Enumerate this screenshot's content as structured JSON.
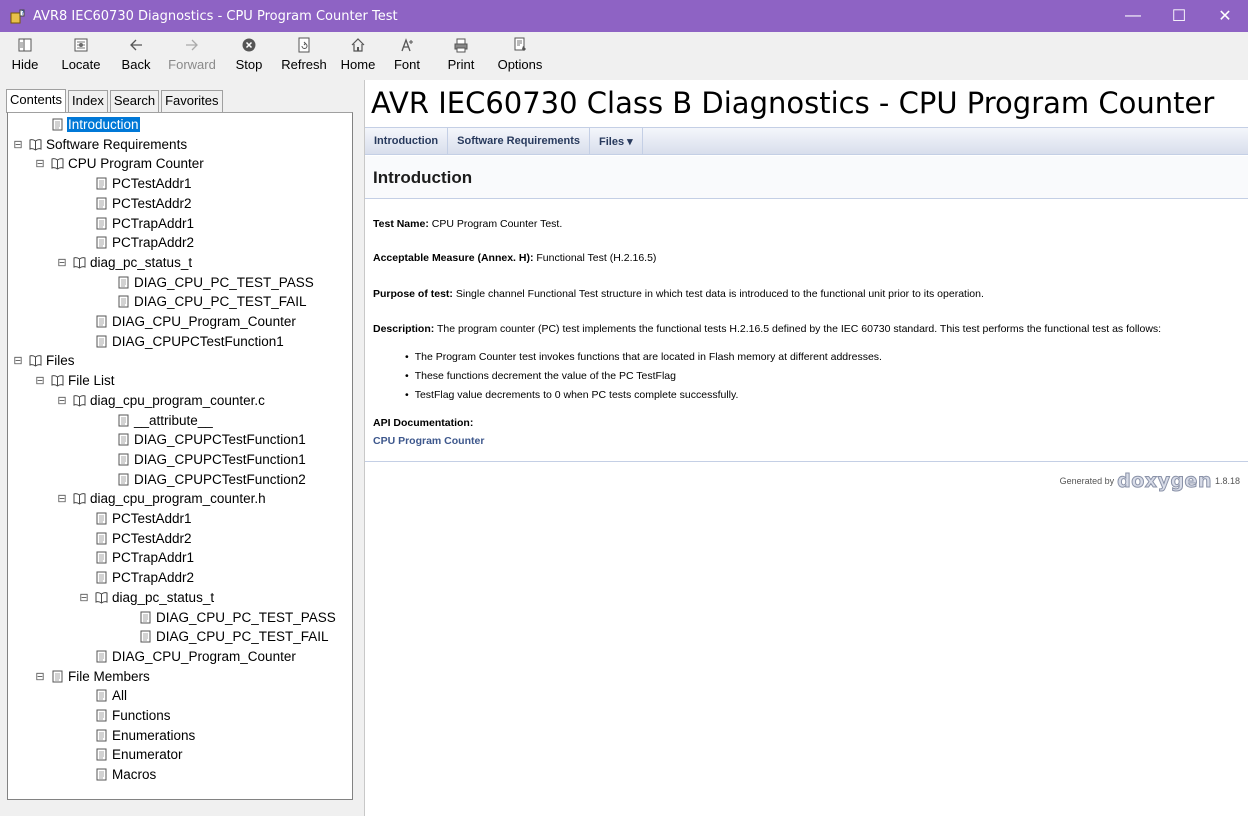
{
  "window": {
    "title": "AVR8 IEC60730 Diagnostics - CPU Program Counter Test",
    "controls": [
      "—",
      "☐",
      "✕"
    ]
  },
  "toolbar": {
    "hide": "Hide",
    "locate": "Locate",
    "back": "Back",
    "forward": "Forward",
    "stop": "Stop",
    "refresh": "Refresh",
    "home": "Home",
    "font": "Font",
    "print": "Print",
    "options": "Options"
  },
  "tabs": {
    "contents": "Contents",
    "index": "Index",
    "search": "Search",
    "favorites": "Favorites"
  },
  "tree": [
    {
      "label": "Introduction",
      "type": "page",
      "expander": "",
      "selected": true
    },
    {
      "label": "Software Requirements",
      "type": "book",
      "expander": "⊟"
    },
    {
      "label": "CPU Program Counter",
      "type": "book",
      "expander": "⊟"
    },
    {
      "label": "PCTestAddr1",
      "type": "page",
      "expander": ""
    },
    {
      "label": "PCTestAddr2",
      "type": "page",
      "expander": ""
    },
    {
      "label": "PCTrapAddr1",
      "type": "page",
      "expander": ""
    },
    {
      "label": "PCTrapAddr2",
      "type": "page",
      "expander": ""
    },
    {
      "label": "diag_pc_status_t",
      "type": "book",
      "expander": "⊟"
    },
    {
      "label": "DIAG_CPU_PC_TEST_PASS",
      "type": "page",
      "expander": ""
    },
    {
      "label": "DIAG_CPU_PC_TEST_FAIL",
      "type": "page",
      "expander": ""
    },
    {
      "label": "DIAG_CPU_Program_Counter",
      "type": "page",
      "expander": ""
    },
    {
      "label": "DIAG_CPUPCTestFunction1",
      "type": "page",
      "expander": ""
    },
    {
      "label": "Files",
      "type": "book",
      "expander": "⊟"
    },
    {
      "label": "File List",
      "type": "book",
      "expander": "⊟"
    },
    {
      "label": "diag_cpu_program_counter.c",
      "type": "book",
      "expander": "⊟"
    },
    {
      "label": "__attribute__",
      "type": "page",
      "expander": ""
    },
    {
      "label": "DIAG_CPUPCTestFunction1",
      "type": "page",
      "expander": ""
    },
    {
      "label": "DIAG_CPUPCTestFunction1",
      "type": "page",
      "expander": ""
    },
    {
      "label": "DIAG_CPUPCTestFunction2",
      "type": "page",
      "expander": ""
    },
    {
      "label": "diag_cpu_program_counter.h",
      "type": "book",
      "expander": "⊟"
    },
    {
      "label": "PCTestAddr1",
      "type": "page",
      "expander": ""
    },
    {
      "label": "PCTestAddr2",
      "type": "page",
      "expander": ""
    },
    {
      "label": "PCTrapAddr1",
      "type": "page",
      "expander": ""
    },
    {
      "label": "PCTrapAddr2",
      "type": "page",
      "expander": ""
    },
    {
      "label": "diag_pc_status_t",
      "type": "book",
      "expander": "⊟"
    },
    {
      "label": "DIAG_CPU_PC_TEST_PASS",
      "type": "page",
      "expander": ""
    },
    {
      "label": "DIAG_CPU_PC_TEST_FAIL",
      "type": "page",
      "expander": ""
    },
    {
      "label": "DIAG_CPU_Program_Counter",
      "type": "page",
      "expander": ""
    },
    {
      "label": "File Members",
      "type": "page",
      "expander": "⊟"
    },
    {
      "label": "All",
      "type": "page",
      "expander": ""
    },
    {
      "label": "Functions",
      "type": "page",
      "expander": ""
    },
    {
      "label": "Enumerations",
      "type": "page",
      "expander": ""
    },
    {
      "label": "Enumerator",
      "type": "page",
      "expander": ""
    },
    {
      "label": "Macros",
      "type": "page",
      "expander": ""
    }
  ],
  "doc": {
    "title": "AVR IEC60730 Class B Diagnostics - CPU Program Counter",
    "nav": {
      "introduction": "Introduction",
      "software_requirements": "Software Requirements",
      "files": "Files ▾"
    },
    "heading": "Introduction",
    "test_name_label": "Test Name:",
    "test_name": " CPU Program Counter Test.",
    "measure_label": "Acceptable Measure (Annex. H):",
    "measure": " Functional Test (H.2.16.5)",
    "purpose_label": "Purpose of test:",
    "purpose": " Single channel Functional Test structure in which test data is introduced to the functional unit prior to its operation.",
    "description_label": "Description:",
    "description": " The program counter (PC) test implements the functional tests H.2.16.5 defined by the IEC 60730 standard. This test performs the functional test as follows:",
    "bullets": [
      "The Program Counter test invokes functions that are located in Flash memory at different addresses.",
      "These functions decrement the value of the PC TestFlag",
      "TestFlag value decrements to 0 when PC tests complete successfully."
    ],
    "api_label": "API Documentation:",
    "api_link": "CPU Program Counter",
    "footer_generated": "Generated by",
    "footer_logo": "doxygen",
    "footer_version": "1.8.18"
  }
}
